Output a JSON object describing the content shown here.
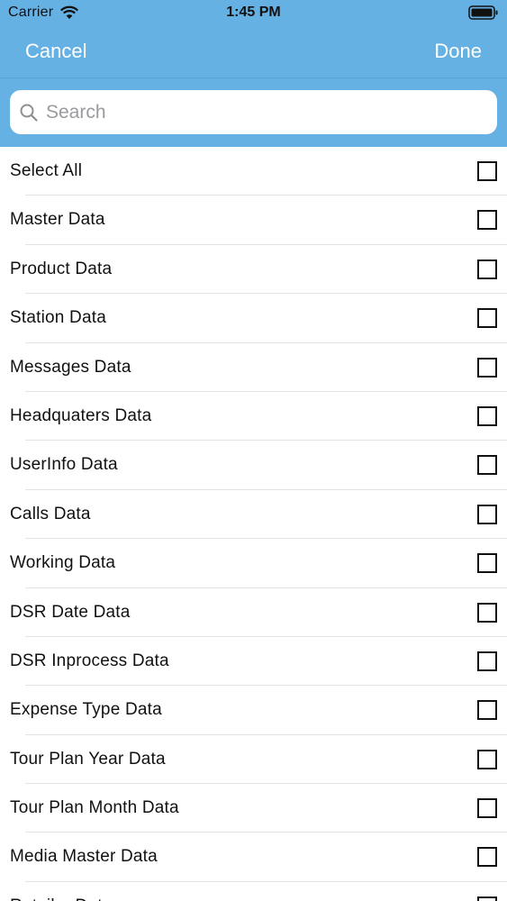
{
  "status_bar": {
    "carrier": "Carrier",
    "time": "1:45 PM"
  },
  "nav": {
    "cancel_label": "Cancel",
    "done_label": "Done"
  },
  "search": {
    "placeholder": "Search",
    "value": ""
  },
  "colors": {
    "header_bg": "#66b1e4",
    "nav_text": "#ffffff"
  },
  "items": [
    {
      "label": "Select All",
      "checked": false
    },
    {
      "label": "Master Data",
      "checked": false
    },
    {
      "label": "Product Data",
      "checked": false
    },
    {
      "label": "Station Data",
      "checked": false
    },
    {
      "label": "Messages Data",
      "checked": false
    },
    {
      "label": "Headquaters Data",
      "checked": false
    },
    {
      "label": "UserInfo Data",
      "checked": false
    },
    {
      "label": "Calls Data",
      "checked": false
    },
    {
      "label": "Working Data",
      "checked": false
    },
    {
      "label": "DSR Date Data",
      "checked": false
    },
    {
      "label": "DSR Inprocess Data",
      "checked": false
    },
    {
      "label": "Expense Type Data",
      "checked": false
    },
    {
      "label": "Tour Plan Year Data",
      "checked": false
    },
    {
      "label": "Tour Plan Month Data",
      "checked": false
    },
    {
      "label": "Media Master Data",
      "checked": false
    },
    {
      "label": "Retailer Data",
      "checked": false
    }
  ]
}
